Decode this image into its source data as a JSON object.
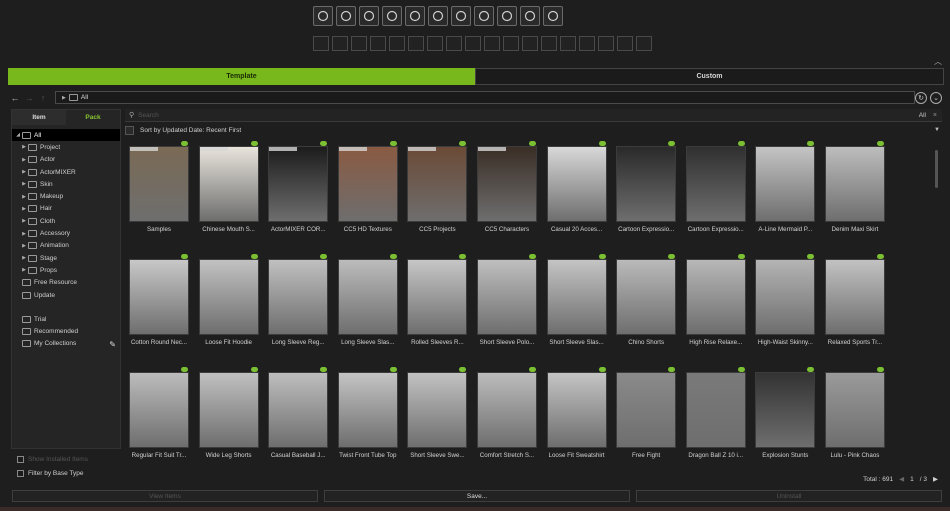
{
  "toolbar": {
    "icons": [
      "folder-icon",
      "human-figure-icon",
      "head-morph-icon",
      "skin-icon",
      "makeup-icon",
      "hair-icon",
      "cloth-icon",
      "accessory-icon",
      "pose-icon",
      "stage-icon",
      "props-icon"
    ],
    "subbar_count": 18
  },
  "tabs": {
    "template": "Template",
    "custom": "Custom"
  },
  "path": {
    "crumb": "All"
  },
  "left": {
    "subtabs": {
      "item": "Item",
      "pack": "Pack"
    },
    "tree": [
      {
        "label": "All",
        "level": 0,
        "selected": true
      },
      {
        "label": "Project",
        "level": 1
      },
      {
        "label": "Actor",
        "level": 1
      },
      {
        "label": "ActorMIXER",
        "level": 1
      },
      {
        "label": "Skin",
        "level": 1
      },
      {
        "label": "Makeup",
        "level": 1
      },
      {
        "label": "Hair",
        "level": 1
      },
      {
        "label": "Cloth",
        "level": 1
      },
      {
        "label": "Accessory",
        "level": 1
      },
      {
        "label": "Animation",
        "level": 1
      },
      {
        "label": "Stage",
        "level": 1
      },
      {
        "label": "Props",
        "level": 1
      },
      {
        "label": "Free Resource",
        "level": 0
      },
      {
        "label": "Update",
        "level": 0
      }
    ],
    "extra": [
      "Trial",
      "Recommended",
      "My Collections"
    ],
    "bottom": {
      "show_installed": "Show Installed Items",
      "filter_base": "Filter by Base Type"
    }
  },
  "search": {
    "placeholder": "Search",
    "scope": "All"
  },
  "sort": {
    "label": "Sort by Updated Date: Recent First"
  },
  "items": [
    {
      "label": "Samples",
      "bg": "#7a6a55"
    },
    {
      "label": "Chinese Mouth S...",
      "bg": "#e8e4dc"
    },
    {
      "label": "ActorMIXER COR...",
      "bg": "#1c1c1c"
    },
    {
      "label": "CC5 HD Textures",
      "bg": "#8a5a42"
    },
    {
      "label": "CC5 Projects",
      "bg": "#6b4a36"
    },
    {
      "label": "CC5 Characters",
      "bg": "#3a2e26"
    },
    {
      "label": "Casual 20 Acces...",
      "bg": "#d8d8d8"
    },
    {
      "label": "Cartoon Expressio...",
      "bg": "#2a2a2a"
    },
    {
      "label": "Cartoon Expressio...",
      "bg": "#303030"
    },
    {
      "label": "A-Line Mermaid P...",
      "bg": "#c4c4c4"
    },
    {
      "label": "Denim Maxi Skirt",
      "bg": "#bdbdbd"
    },
    {
      "label": "Cotton Round Nec...",
      "bg": "#c8c8c8"
    },
    {
      "label": "Loose Fit Hoodie",
      "bg": "#c2c2c2"
    },
    {
      "label": "Long Sleeve Reg...",
      "bg": "#c0c0c0"
    },
    {
      "label": "Long Sleeve Slas...",
      "bg": "#bcbcbc"
    },
    {
      "label": "Rolled Sleeves R...",
      "bg": "#c6c6c6"
    },
    {
      "label": "Short Sleeve Polo...",
      "bg": "#bfbfbf"
    },
    {
      "label": "Short Sleeve Slas...",
      "bg": "#c4c4c4"
    },
    {
      "label": "Chino Shorts",
      "bg": "#bababa"
    },
    {
      "label": "High Rise Relaxe...",
      "bg": "#b8b8b8"
    },
    {
      "label": "High-Waist Skinny...",
      "bg": "#b4b4b4"
    },
    {
      "label": "Relaxed Sports Tr...",
      "bg": "#c2c2c2"
    },
    {
      "label": "Regular Fit Suit Tr...",
      "bg": "#bcbcbc"
    },
    {
      "label": "Wide Leg Shorts",
      "bg": "#c0c0c0"
    },
    {
      "label": "Casual Baseball J...",
      "bg": "#bebebe"
    },
    {
      "label": "Twist Front Tube Top",
      "bg": "#c4c4c4"
    },
    {
      "label": "Short Sleeve Swe...",
      "bg": "#c2c2c2"
    },
    {
      "label": "Comfort Stretch S...",
      "bg": "#bcbcbc"
    },
    {
      "label": "Loose Fit Sweatshirt",
      "bg": "#c4c4c4"
    },
    {
      "label": "Free Fight",
      "bg": "#8a8a8a"
    },
    {
      "label": "Dragon Ball Z 10 i...",
      "bg": "#7a7a7a"
    },
    {
      "label": "Explosion Stunts",
      "bg": "#333333"
    },
    {
      "label": "Lulu - Pink Chaos",
      "bg": "#9a9a9a"
    }
  ],
  "footer": {
    "total": "Total : 691",
    "page": "1",
    "pages": "/ 3"
  },
  "bottom": {
    "left": "View Items",
    "save": "Save...",
    "right": "Uninstall"
  }
}
